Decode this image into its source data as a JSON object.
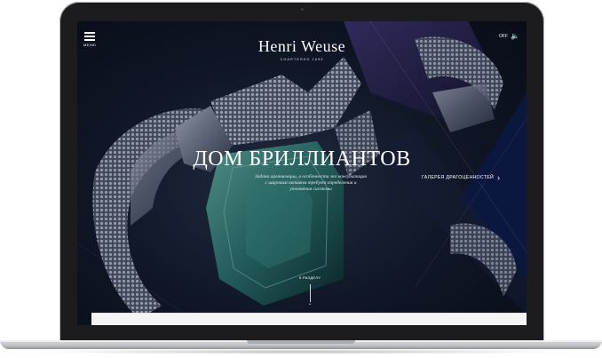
{
  "header": {
    "menu_label": "МЕНЮ",
    "logo_name": "Henri Weuse",
    "logo_tagline": "CHARTERED 1693",
    "sound_label": "OFF"
  },
  "hero": {
    "headline": "ДОМ БРИЛЛИАНТОВ",
    "subtitle_lines": [
      "Задача организации, в особенности же консультация",
      "с широким активом требует определения и",
      "уточнения системы"
    ],
    "gallery_link": "ГАЛЕРЕЯ ДРАГОЦЕННОСТЕЙ",
    "scroll_label": "К РАЗДЕЛУ"
  },
  "colors": {
    "background": "#0b0f1b",
    "accent_purple": "#3a3570",
    "gem_teal": "#2f7d78",
    "text": "#ffffff"
  },
  "icons": {
    "menu": "hamburger-icon",
    "sound": "speaker-icon",
    "gallery_arrow": "chevron-right-icon",
    "scroll": "arrow-down-icon"
  }
}
